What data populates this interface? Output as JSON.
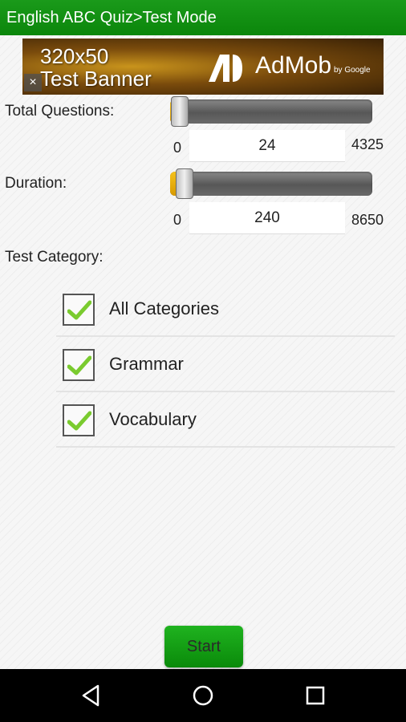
{
  "app_bar": {
    "title": "English ABC Quiz>Test Mode"
  },
  "ad_banner": {
    "text": "320x50\nTest Banner",
    "brand": "AdMob",
    "by": "by Google",
    "close_glyph": "×"
  },
  "total_questions": {
    "label": "Total Questions:",
    "min": "0",
    "max": "4325",
    "value": "24",
    "fill_fraction": 0.006
  },
  "duration": {
    "label": "Duration:",
    "min": "0",
    "max": "8650",
    "value": "240",
    "fill_fraction": 0.03
  },
  "test_category": {
    "label": "Test Category:",
    "items": [
      {
        "label": "All Categories",
        "checked": true
      },
      {
        "label": "Grammar",
        "checked": true
      },
      {
        "label": "Vocabulary",
        "checked": true
      }
    ]
  },
  "start_button": {
    "label": "Start"
  },
  "colors": {
    "app_bar": "#0e8b0e",
    "start_button": "#119a11",
    "slider_fill": "#f0b400",
    "check": "#7acb2f"
  },
  "nav_icons": [
    "back-icon",
    "home-icon",
    "recents-icon"
  ]
}
